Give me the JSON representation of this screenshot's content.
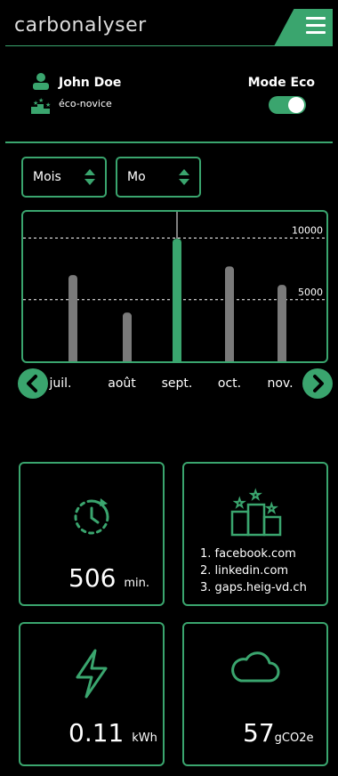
{
  "app": {
    "title": "carbonalyser"
  },
  "user": {
    "name": "John Doe",
    "level": "éco-novice",
    "eco_label": "Mode Eco",
    "eco_on": true
  },
  "selects": {
    "period": "Mois",
    "metric": "Mo"
  },
  "chart_data": {
    "type": "bar",
    "categories": [
      "juil.",
      "août",
      "sept.",
      "oct.",
      "nov."
    ],
    "values": [
      7000,
      3950,
      9950,
      7700,
      6200
    ],
    "ylim": [
      0,
      11700
    ],
    "reference_lines": [
      {
        "value": 10000,
        "label": "10000"
      },
      {
        "value": 5000,
        "label": "5000"
      }
    ],
    "selected_index": 2,
    "colors": {
      "bar": "#7a7a7a",
      "selected": "#3aa56e",
      "line": "#ffffff"
    }
  },
  "stats": {
    "time": {
      "value": "506",
      "unit": "min."
    },
    "top_sites": [
      "1. facebook.com",
      "2. linkedin.com",
      "3. gaps.heig-vd.ch"
    ],
    "energy": {
      "value": "0.11",
      "unit": "kWh"
    },
    "emission": {
      "value": "57",
      "unit": "gCO2e"
    }
  },
  "icons": {
    "menu": "hamburger-icon",
    "user": "user-icon",
    "level": "podium-icon",
    "select_arrows": "sort-arrows-icon",
    "prev": "chevron-left-icon",
    "next": "chevron-right-icon",
    "time": "timer-icon",
    "ranking": "podium-stars-icon",
    "energy": "lightning-icon",
    "emission": "cloud-icon"
  },
  "colors": {
    "accent": "#3aa56e",
    "background": "#000000",
    "text": "#ffffff"
  }
}
